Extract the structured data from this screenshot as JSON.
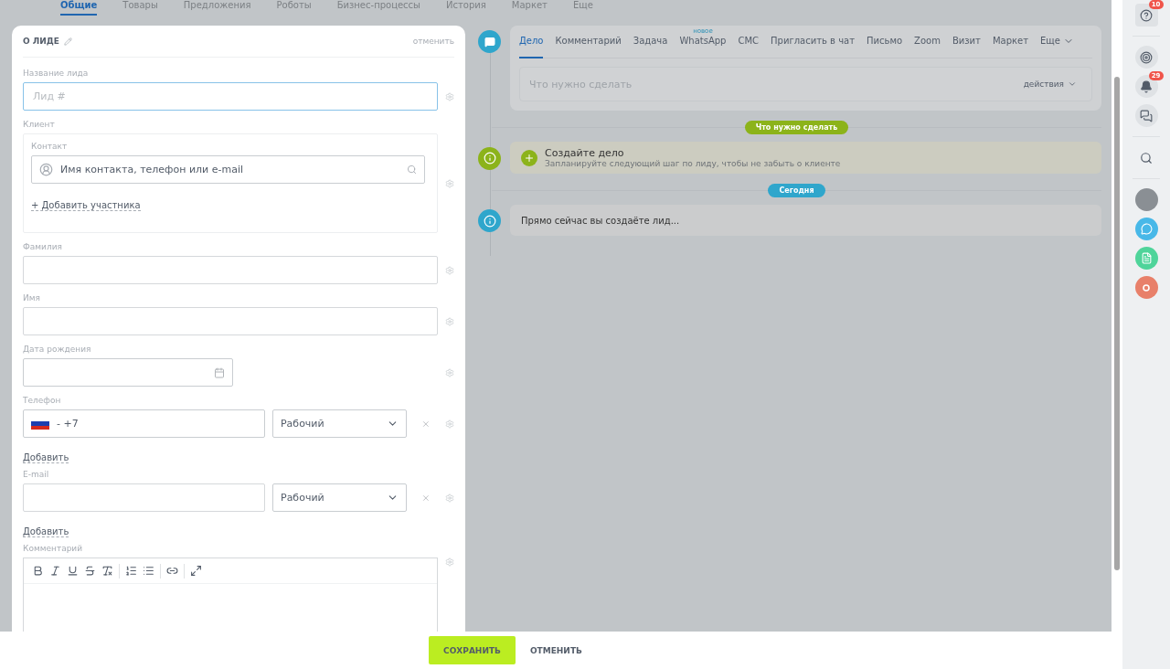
{
  "top_tabs": [
    {
      "label": "Общие",
      "selected": true
    },
    {
      "label": "Товары",
      "selected": false
    },
    {
      "label": "Предложения",
      "selected": false
    },
    {
      "label": "Роботы",
      "selected": false
    },
    {
      "label": "Бизнес-процессы",
      "selected": false
    },
    {
      "label": "История",
      "selected": false
    },
    {
      "label": "Маркет",
      "selected": false
    },
    {
      "label": "Еще",
      "selected": false
    }
  ],
  "lead_card": {
    "title": "О ЛИДЕ",
    "cancel_link": "отменить",
    "name_field": {
      "label": "Название лида",
      "placeholder": "Лид #",
      "focused": true
    },
    "client": {
      "label": "Клиент",
      "contact_label": "Контакт",
      "placeholder": "Имя контакта, телефон или e-mail",
      "add_link": "+ Добавить участника"
    },
    "last_name": {
      "label": "Фамилия"
    },
    "first_name": {
      "label": "Имя"
    },
    "birth_date": {
      "label": "Дата рождения"
    },
    "phone": {
      "label": "Телефон",
      "value": "- +7",
      "type": "Рабочий",
      "add_link": "Добавить"
    },
    "email": {
      "label": "E-mail",
      "type": "Рабочий",
      "add_link": "Добавить"
    },
    "comment": {
      "label": "Комментарий"
    }
  },
  "activity_tabs": [
    {
      "label": "Дело",
      "selected": true
    },
    {
      "label": "Комментарий",
      "selected": false
    },
    {
      "label": "Задача",
      "selected": false
    },
    {
      "label": "WhatsApp",
      "selected": false,
      "badge": "новое"
    },
    {
      "label": "СМС",
      "selected": false
    },
    {
      "label": "Пригласить в чат",
      "selected": false
    },
    {
      "label": "Письмо",
      "selected": false
    },
    {
      "label": "Zoom",
      "selected": false
    },
    {
      "label": "Визит",
      "selected": false
    },
    {
      "label": "Маркет",
      "selected": false
    },
    {
      "label": "Еще",
      "selected": false,
      "dropdown": true
    }
  ],
  "task_input": {
    "placeholder": "Что нужно сделать",
    "actions": "действия"
  },
  "timeline": [
    {
      "kind": "divider",
      "label": "Что нужно сделать",
      "color": "#8cb31a"
    },
    {
      "kind": "task",
      "title": "Создайте дело",
      "subtitle": "Запланируйте следующий шаг по лиду, чтобы не забыть о клиенте",
      "color": "#8cb31a"
    },
    {
      "kind": "divider",
      "label": "Сегодня",
      "color": "#2fa6cc"
    },
    {
      "kind": "info",
      "text": "Прямо сейчас вы создаёте лид...",
      "color": "#2fa6cc"
    }
  ],
  "sidebar": {
    "help_badge": "10",
    "notifications_badge": "29"
  },
  "footer": {
    "save": "СОХРАНИТЬ",
    "cancel": "ОТМЕНИТЬ"
  }
}
